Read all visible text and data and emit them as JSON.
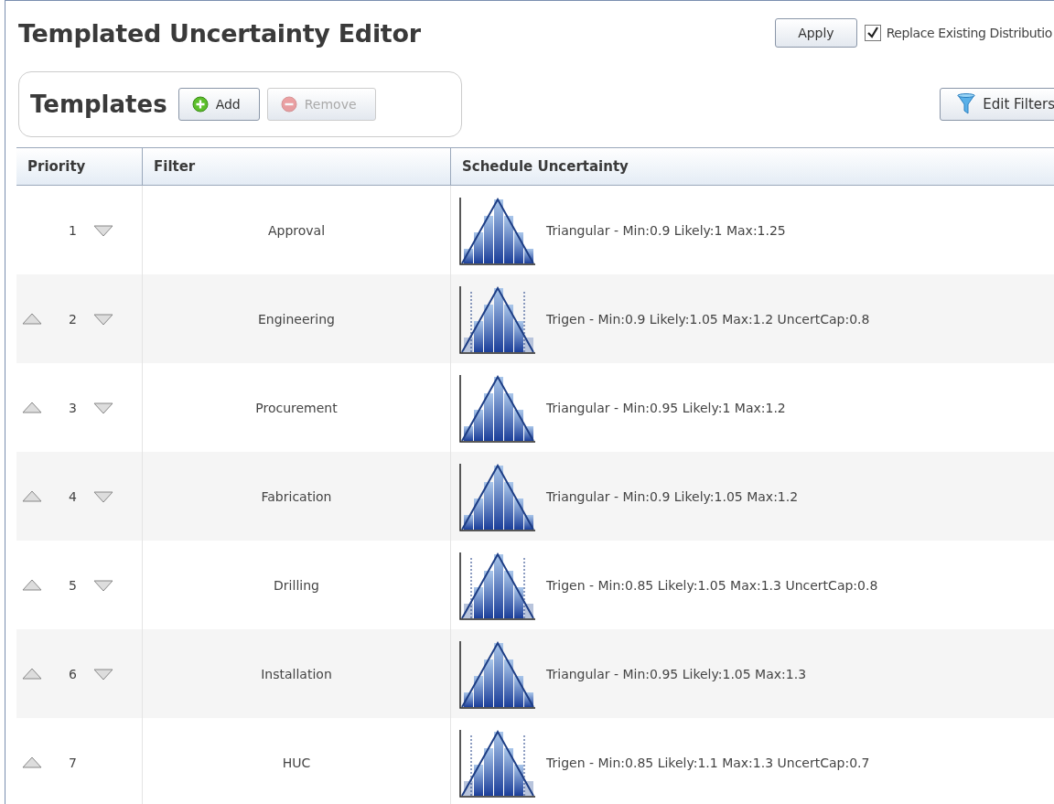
{
  "title": "Templated Uncertainty Editor",
  "apply_button": {
    "label": "Apply"
  },
  "replace_checkbox": {
    "label": "Replace Existing Distributio",
    "checked": true
  },
  "templates": {
    "heading": "Templates",
    "add_button": {
      "label": "Add",
      "disabled": false
    },
    "remove_button": {
      "label": "Remove",
      "disabled": true
    }
  },
  "edit_filters_button": {
    "label": "Edit Filters"
  },
  "table": {
    "columns": [
      "Priority",
      "Filter",
      "Schedule Uncertainty"
    ],
    "rows": [
      {
        "priority": "1",
        "can_move_up": false,
        "can_move_down": true,
        "filter": "Approval",
        "kind": "triangular",
        "uncertainty": "Triangular - Min:0.9 Likely:1 Max:1.25"
      },
      {
        "priority": "2",
        "can_move_up": true,
        "can_move_down": true,
        "filter": "Engineering",
        "kind": "trigen",
        "uncertainty": "Trigen - Min:0.9 Likely:1.05 Max:1.2 UncertCap:0.8"
      },
      {
        "priority": "3",
        "can_move_up": true,
        "can_move_down": true,
        "filter": "Procurement",
        "kind": "triangular",
        "uncertainty": "Triangular - Min:0.95 Likely:1 Max:1.2"
      },
      {
        "priority": "4",
        "can_move_up": true,
        "can_move_down": true,
        "filter": "Fabrication",
        "kind": "triangular",
        "uncertainty": "Triangular - Min:0.9 Likely:1.05 Max:1.2"
      },
      {
        "priority": "5",
        "can_move_up": true,
        "can_move_down": true,
        "filter": "Drilling",
        "kind": "trigen",
        "uncertainty": "Trigen - Min:0.85 Likely:1.05 Max:1.3 UncertCap:0.8"
      },
      {
        "priority": "6",
        "can_move_up": true,
        "can_move_down": true,
        "filter": "Installation",
        "kind": "triangular",
        "uncertainty": "Triangular - Min:0.95 Likely:1.05 Max:1.3"
      },
      {
        "priority": "7",
        "can_move_up": true,
        "can_move_down": false,
        "filter": "HUC",
        "kind": "trigen",
        "uncertainty": "Trigen - Min:0.85 Likely:1.1 Max:1.3 UncertCap:0.7"
      }
    ]
  }
}
